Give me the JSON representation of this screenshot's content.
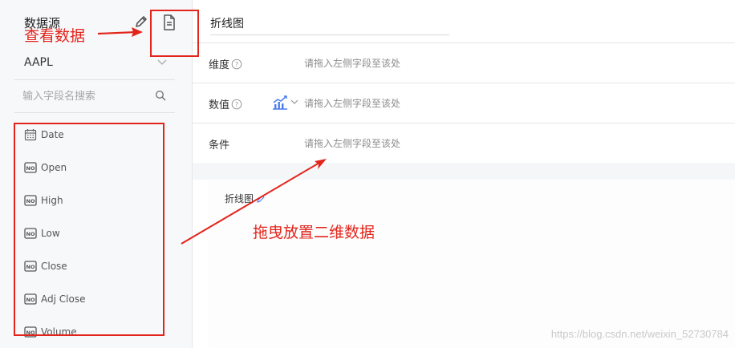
{
  "sidebar": {
    "title": "数据源",
    "data_source": "AAPL",
    "search_placeholder": "输入字段名搜索",
    "fields": [
      {
        "label": "Date",
        "icon": "calendar-icon"
      },
      {
        "label": "Open",
        "icon": "number-field-icon"
      },
      {
        "label": "High",
        "icon": "number-field-icon"
      },
      {
        "label": "Low",
        "icon": "number-field-icon"
      },
      {
        "label": "Close",
        "icon": "number-field-icon"
      },
      {
        "label": "Adj Close",
        "icon": "number-field-icon"
      },
      {
        "label": "Volume",
        "icon": "number-field-icon"
      }
    ]
  },
  "editor": {
    "chart_name": "折线图",
    "rows": [
      {
        "label": "维度",
        "placeholder": "请拖入左侧字段至该处"
      },
      {
        "label": "数值",
        "placeholder": "请拖入左侧字段至该处"
      },
      {
        "label": "条件",
        "placeholder": "请拖入左侧字段至该处"
      }
    ],
    "preview_title": "折线图"
  },
  "annotations": {
    "view_data": "查看数据",
    "drag_hint": "拖曳放置二维数据"
  },
  "watermark": "https://blog.csdn.net/weixin_52730784",
  "colors": {
    "annotation_red": "#e3241b",
    "accent_blue": "#4a7cf0"
  }
}
